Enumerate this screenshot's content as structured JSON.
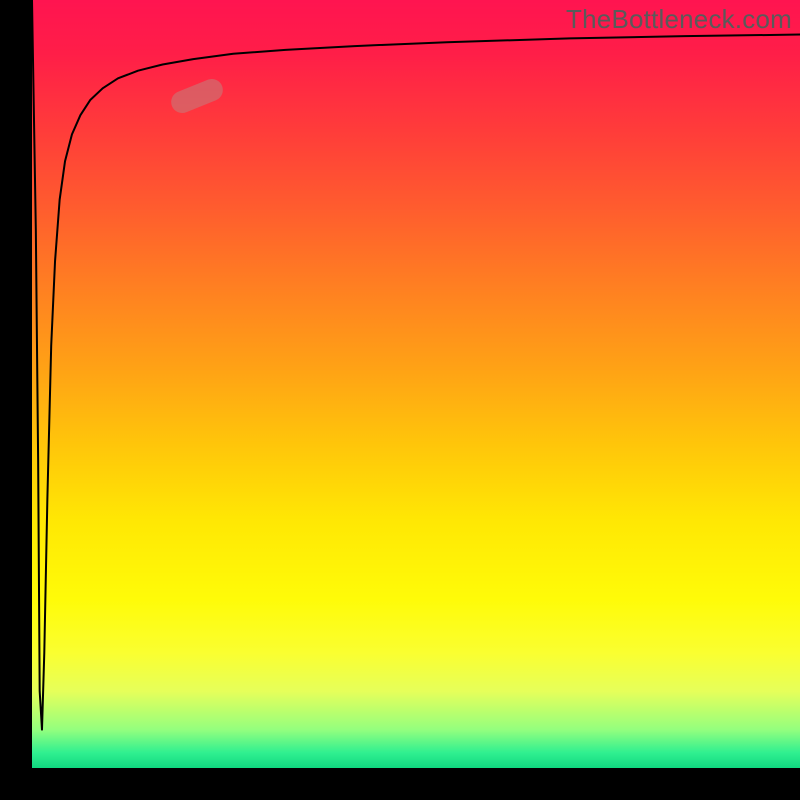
{
  "watermark": "TheBottleneck.com",
  "colors": {
    "axis": "#000000",
    "curve": "#000000",
    "marker": "rgba(200,120,120,0.62)"
  },
  "chart_data": {
    "type": "line",
    "title": "",
    "xlabel": "",
    "ylabel": "",
    "xlim": [
      0,
      100
    ],
    "ylim": [
      0,
      100
    ],
    "grid": false,
    "legend": false,
    "series": [
      {
        "name": "bottleneck-curve",
        "x": [
          0.0,
          0.5,
          0.8,
          1.0,
          1.3,
          1.6,
          2.0,
          2.5,
          3.0,
          3.6,
          4.3,
          5.2,
          6.3,
          7.6,
          9.2,
          11.2,
          13.8,
          17.0,
          21.0,
          26.2,
          33.0,
          42.0,
          54.0,
          70.0,
          85.0,
          100.0
        ],
        "y": [
          100.0,
          70.0,
          40.0,
          10.0,
          5.0,
          15.0,
          35.0,
          55.0,
          66.0,
          74.0,
          79.0,
          82.5,
          85.0,
          87.0,
          88.5,
          89.8,
          90.8,
          91.6,
          92.3,
          93.0,
          93.5,
          94.0,
          94.5,
          95.0,
          95.3,
          95.5
        ]
      }
    ],
    "annotations": [
      {
        "name": "highlight-marker",
        "x": 21.5,
        "y": 87.5,
        "angle_deg": -22
      }
    ]
  }
}
